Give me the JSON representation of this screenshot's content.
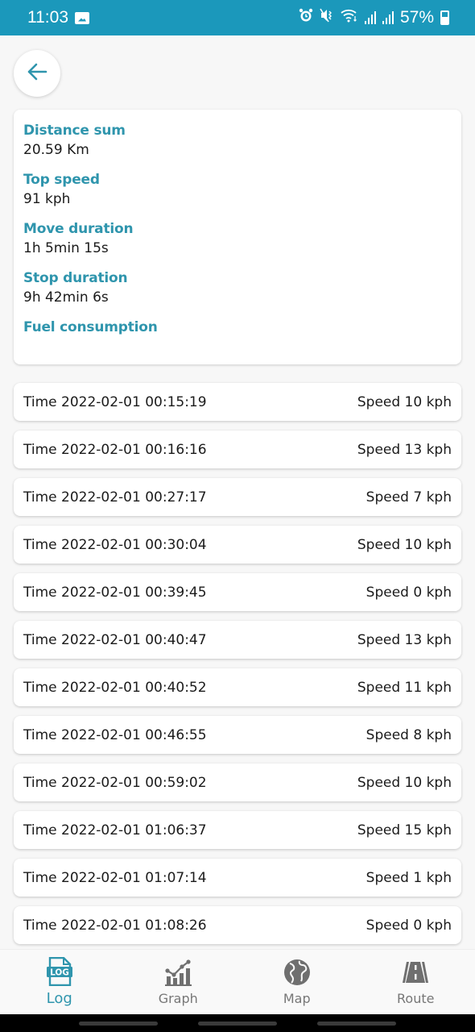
{
  "status_bar": {
    "time": "11:03",
    "battery": "57%",
    "icons": [
      "image-icon",
      "alarm-icon",
      "mute-vibrate-icon",
      "wifi-icon",
      "signal-icon",
      "signal-icon",
      "battery-icon"
    ]
  },
  "header": {
    "back_icon": "arrow-left-icon"
  },
  "colors": {
    "accent": "#2f95ad",
    "status_bar": "#1b98bb",
    "inactive": "#777777"
  },
  "summary": {
    "items": [
      {
        "label": "Distance sum",
        "value": "20.59 Km"
      },
      {
        "label": "Top speed",
        "value": "91 kph"
      },
      {
        "label": "Move duration",
        "value": "1h 5min 15s"
      },
      {
        "label": "Stop duration",
        "value": "9h 42min 6s"
      },
      {
        "label": "Fuel consumption",
        "value": ""
      }
    ]
  },
  "log": {
    "rows": [
      {
        "time": "Time 2022-02-01 00:15:19",
        "speed": "Speed 10 kph"
      },
      {
        "time": "Time 2022-02-01 00:16:16",
        "speed": "Speed 13 kph"
      },
      {
        "time": "Time 2022-02-01 00:27:17",
        "speed": "Speed 7 kph"
      },
      {
        "time": "Time 2022-02-01 00:30:04",
        "speed": "Speed 10 kph"
      },
      {
        "time": "Time 2022-02-01 00:39:45",
        "speed": "Speed 0 kph"
      },
      {
        "time": "Time 2022-02-01 00:40:47",
        "speed": "Speed 13 kph"
      },
      {
        "time": "Time 2022-02-01 00:40:52",
        "speed": "Speed 11 kph"
      },
      {
        "time": "Time 2022-02-01 00:46:55",
        "speed": "Speed 8 kph"
      },
      {
        "time": "Time 2022-02-01 00:59:02",
        "speed": "Speed 10 kph"
      },
      {
        "time": "Time 2022-02-01 01:06:37",
        "speed": "Speed 15 kph"
      },
      {
        "time": "Time 2022-02-01 01:07:14",
        "speed": "Speed 1 kph"
      },
      {
        "time": "Time 2022-02-01 01:08:26",
        "speed": "Speed 0 kph"
      }
    ]
  },
  "bottom_nav": {
    "items": [
      {
        "label": "Log",
        "icon": "log-file-icon",
        "active": true
      },
      {
        "label": "Graph",
        "icon": "chart-icon",
        "active": false
      },
      {
        "label": "Map",
        "icon": "globe-icon",
        "active": false
      },
      {
        "label": "Route",
        "icon": "road-icon",
        "active": false
      }
    ]
  }
}
